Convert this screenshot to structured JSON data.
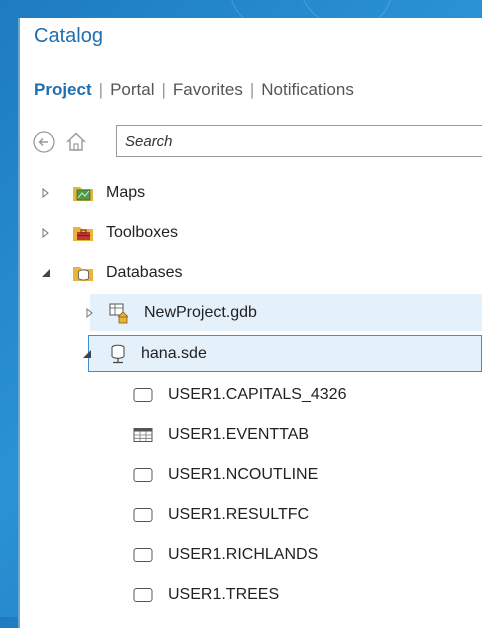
{
  "window": {
    "title": "Catalog"
  },
  "tabs": [
    {
      "label": "Project",
      "active": true
    },
    {
      "label": "Portal",
      "active": false
    },
    {
      "label": "Favorites",
      "active": false
    },
    {
      "label": "Notifications",
      "active": false
    }
  ],
  "toolbar": {
    "back_icon": "back-arrow-icon",
    "home_icon": "home-icon",
    "search_placeholder": "Search"
  },
  "tree": {
    "maps": {
      "label": "Maps",
      "expanded": false,
      "icon": "folder-maps-icon"
    },
    "toolboxes": {
      "label": "Toolboxes",
      "expanded": false,
      "icon": "folder-toolbox-icon"
    },
    "databases": {
      "label": "Databases",
      "expanded": true,
      "icon": "folder-databases-icon"
    },
    "gdb": {
      "label": "NewProject.gdb",
      "expanded": false,
      "icon": "home-geodatabase-icon"
    },
    "sde": {
      "label": "hana.sde",
      "expanded": true,
      "selected": true,
      "icon": "database-connection-icon"
    },
    "items": [
      {
        "label": "USER1.CAPITALS_4326",
        "icon": "feature-class-icon"
      },
      {
        "label": "USER1.EVENTTAB",
        "icon": "table-icon"
      },
      {
        "label": "USER1.NCOUTLINE",
        "icon": "feature-class-icon"
      },
      {
        "label": "USER1.RESULTFC",
        "icon": "feature-class-icon"
      },
      {
        "label": "USER1.RICHLANDS",
        "icon": "feature-class-icon"
      },
      {
        "label": "USER1.TREES",
        "icon": "feature-class-icon"
      }
    ]
  },
  "colors": {
    "accent": "#1f6fb0",
    "selection": "#e4f0fa",
    "selection_border": "#3d8fd1",
    "background": "#2a93d5"
  }
}
